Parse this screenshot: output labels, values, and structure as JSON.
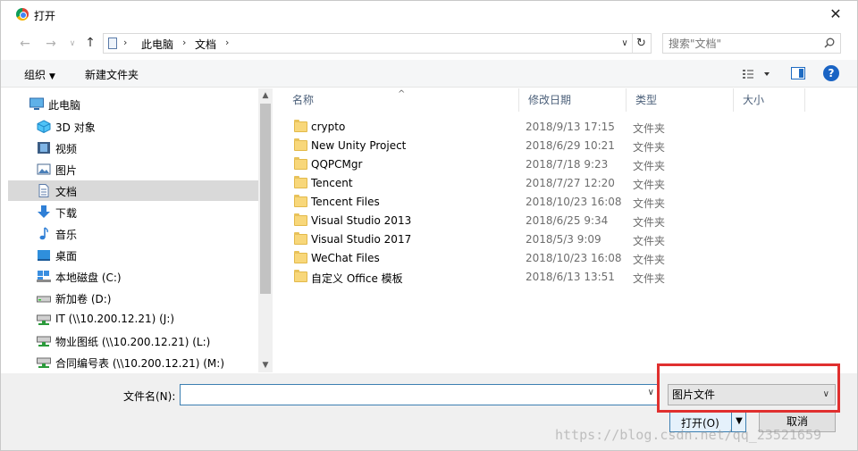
{
  "window": {
    "title": "打开",
    "close_label": "✕"
  },
  "address": {
    "crumbs": [
      "此电脑",
      "文档"
    ],
    "search_placeholder": "搜索\"文档\""
  },
  "toolbar": {
    "organize_label": "组织",
    "new_folder_label": "新建文件夹",
    "help_label": "?"
  },
  "nav": {
    "items": [
      {
        "label": "此电脑",
        "icon": "computer-icon"
      },
      {
        "label": "3D 对象",
        "icon": "3d-objects-icon"
      },
      {
        "label": "视频",
        "icon": "video-icon"
      },
      {
        "label": "图片",
        "icon": "pictures-icon"
      },
      {
        "label": "文档",
        "icon": "documents-icon",
        "selected": true
      },
      {
        "label": "下载",
        "icon": "download-icon"
      },
      {
        "label": "音乐",
        "icon": "music-icon"
      },
      {
        "label": "桌面",
        "icon": "desktop-icon"
      },
      {
        "label": "本地磁盘 (C:)",
        "icon": "windows-drive-icon"
      },
      {
        "label": "新加卷 (D:)",
        "icon": "drive-icon"
      },
      {
        "label": "IT (\\\\10.200.12.21) (J:)",
        "icon": "network-drive-icon"
      },
      {
        "label": "物业图纸 (\\\\10.200.12.21) (L:)",
        "icon": "network-drive-icon"
      },
      {
        "label": "合同编号表 (\\\\10.200.12.21) (M:)",
        "icon": "network-drive-icon"
      }
    ]
  },
  "columns": {
    "name": "名称",
    "modified": "修改日期",
    "type": "类型",
    "size": "大小"
  },
  "files": [
    {
      "name": "crypto",
      "modified": "2018/9/13 17:15",
      "type": "文件夹"
    },
    {
      "name": "New Unity Project",
      "modified": "2018/6/29 10:21",
      "type": "文件夹"
    },
    {
      "name": "QQPCMgr",
      "modified": "2018/7/18 9:23",
      "type": "文件夹"
    },
    {
      "name": "Tencent",
      "modified": "2018/7/27 12:20",
      "type": "文件夹"
    },
    {
      "name": "Tencent Files",
      "modified": "2018/10/23 16:08",
      "type": "文件夹"
    },
    {
      "name": "Visual Studio 2013",
      "modified": "2018/6/25 9:34",
      "type": "文件夹"
    },
    {
      "name": "Visual Studio 2017",
      "modified": "2018/5/3 9:09",
      "type": "文件夹"
    },
    {
      "name": "WeChat Files",
      "modified": "2018/10/23 16:08",
      "type": "文件夹"
    },
    {
      "name": "自定义 Office 模板",
      "modified": "2018/6/13 13:51",
      "type": "文件夹"
    }
  ],
  "footer": {
    "filename_label": "文件名(N):",
    "filename_value": "",
    "filter_value": "图片文件",
    "open_label": "打开(O)",
    "cancel_label": "取消"
  },
  "watermark": "https://blog.csdn.net/qq_23521659",
  "colors": {
    "accent": "#1a64c4",
    "highlight_border": "#e0302f",
    "selected_row": "#d9d9d9"
  }
}
